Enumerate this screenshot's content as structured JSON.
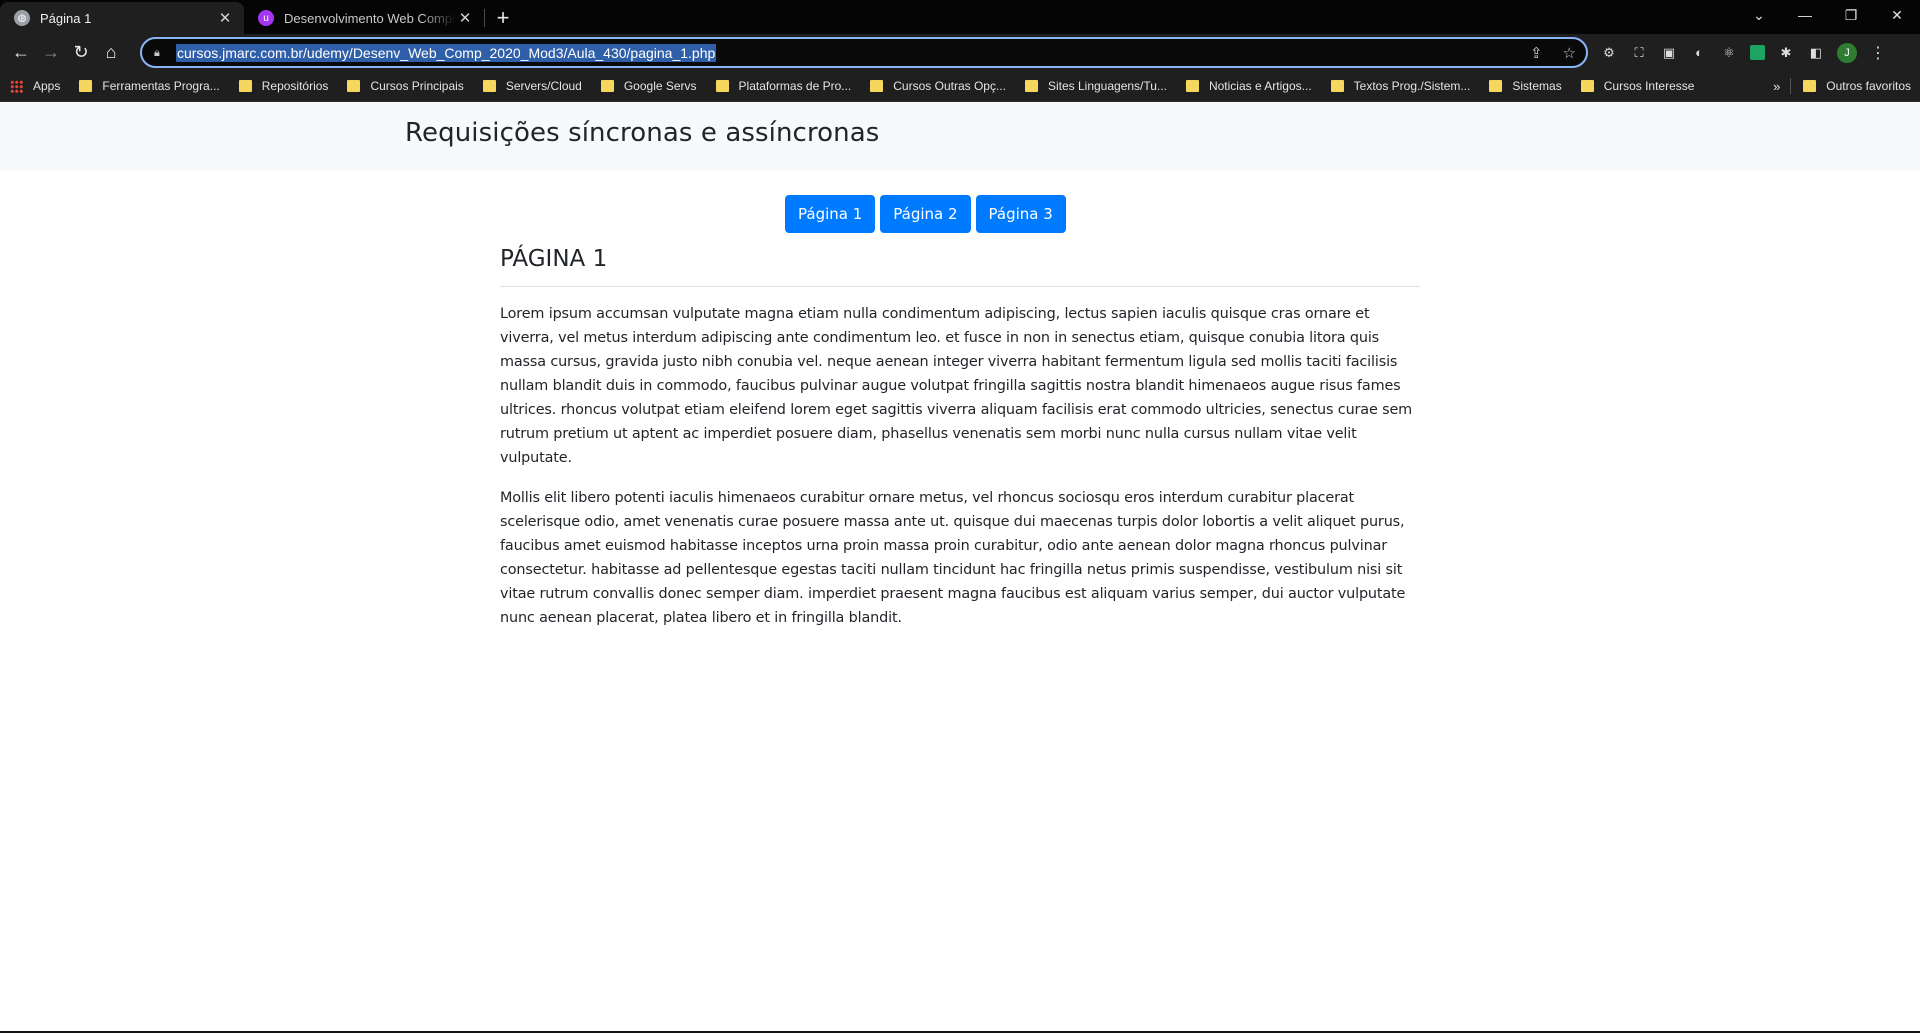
{
  "browser": {
    "tabs": [
      {
        "title": "Página 1",
        "active": true
      },
      {
        "title": "Desenvolvimento Web Completo",
        "active": false
      }
    ],
    "url": "cursos.jmarc.com.br/udemy/Desenv_Web_Comp_2020_Mod3/Aula_430/pagina_1.php",
    "bookmarks": [
      "Apps",
      "Ferramentas Progra...",
      "Repositórios",
      "Cursos Principais",
      "Servers/Cloud",
      "Google Servs",
      "Plataformas de Pro...",
      "Cursos Outras Opç...",
      "Sites Linguagens/Tu...",
      "Noticias e Artigos...",
      "Textos Prog./Sistem...",
      "Sistemas",
      "Cursos Interesse"
    ],
    "bookmarks_more": "»",
    "other_bookmarks": "Outros favoritos",
    "profile_initial": "J"
  },
  "page": {
    "header_title": "Requisições síncronas e assíncronas",
    "buttons": [
      "Página 1",
      "Página 2",
      "Página 3"
    ],
    "heading": "PÁGINA 1",
    "paragraphs": [
      "Lorem ipsum accumsan vulputate magna etiam nulla condimentum adipiscing, lectus sapien iaculis quisque cras ornare et viverra, vel metus interdum adipiscing ante condimentum leo. et fusce in non in senectus etiam, quisque conubia litora quis massa cursus, gravida justo nibh conubia vel. neque aenean integer viverra habitant fermentum ligula sed mollis taciti facilisis nullam blandit duis in commodo, faucibus pulvinar augue volutpat fringilla sagittis nostra blandit himenaeos augue risus fames ultrices. rhoncus volutpat etiam eleifend lorem eget sagittis viverra aliquam facilisis erat commodo ultricies, senectus curae sem rutrum pretium ut aptent ac imperdiet posuere diam, phasellus venenatis sem morbi nunc nulla cursus nullam vitae velit vulputate.",
      "Mollis elit libero potenti iaculis himenaeos curabitur ornare metus, vel rhoncus sociosqu eros interdum curabitur placerat scelerisque odio, amet venenatis curae posuere massa ante ut. quisque dui maecenas turpis dolor lobortis a velit aliquet purus, faucibus amet euismod habitasse inceptos urna proin massa proin curabitur, odio ante aenean dolor magna rhoncus pulvinar consectetur. habitasse ad pellentesque egestas taciti nullam tincidunt hac fringilla netus primis suspendisse, vestibulum nisi sit vitae rutrum convallis donec semper diam. imperdiet praesent magna faucibus est aliquam varius semper, dui auctor vulputate nunc aenean placerat, platea libero et in fringilla blandit."
    ]
  },
  "colors": {
    "primary_button": "#007bff",
    "header_bg": "#f8f9fa",
    "text": "#212529",
    "chrome_bg": "#1f1f1f",
    "bookmark_folder": "#f4d75c"
  }
}
